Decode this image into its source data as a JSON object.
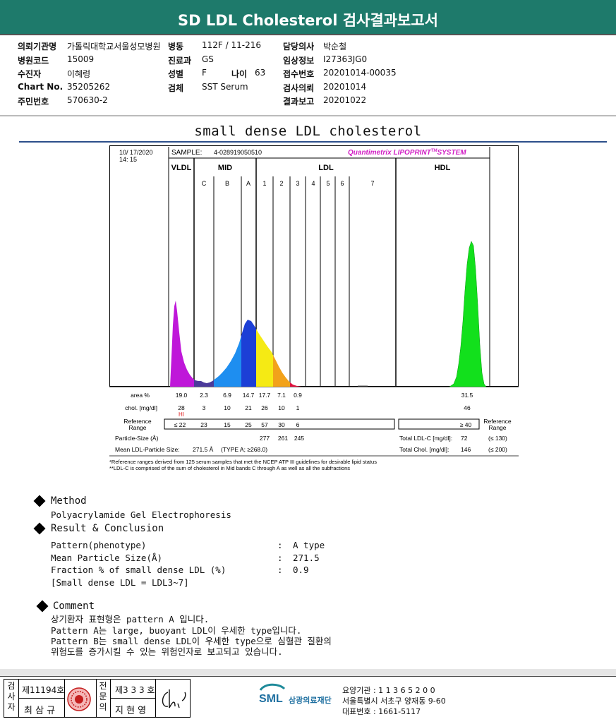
{
  "header": {
    "title": "SD LDL Cholesterol 검사결과보고서"
  },
  "info_left": [
    {
      "label": "의뢰기관명",
      "value": "가톨릭대학교서울성모병원"
    },
    {
      "label": "병원코드",
      "value": "15009"
    },
    {
      "label": "수진자",
      "value": "이혜령"
    },
    {
      "label": "Chart No.",
      "value": "35205262"
    },
    {
      "label": "주민번호",
      "value": "570630-2"
    }
  ],
  "info_mid": [
    {
      "label": "병동",
      "value": "112F / 11-216"
    },
    {
      "label": "진료과",
      "value": "GS"
    },
    {
      "label": "성별",
      "value": "F"
    },
    {
      "label": "검체",
      "value": "SST Serum"
    }
  ],
  "age": {
    "label": "나이",
    "value": "63"
  },
  "info_right": [
    {
      "label": "담당의사",
      "value": "박순철"
    },
    {
      "label": "임상정보",
      "value": "I27363JG0"
    },
    {
      "label": "접수번호",
      "value": "20201014-00035"
    },
    {
      "label": "검사의뢰",
      "value": "20201014"
    },
    {
      "label": "결과보고",
      "value": "20201022"
    }
  ],
  "doc_title": "small dense LDL cholesterol",
  "report": {
    "date": "10/ 17/2020",
    "time": "14: 15",
    "sample_label": "SAMPLE:",
    "sample_id": "4-028919050510",
    "brand": "Quantimetrix LIPOPRINT",
    "brand_tm": "TM",
    "brand_suffix": "SYSTEM",
    "brand_color": "#d11ec4",
    "regions": [
      "VLDL",
      "MID",
      "LDL",
      "HDL"
    ],
    "bands": [
      "C",
      "B",
      "A",
      "1",
      "2",
      "3",
      "4",
      "5",
      "6",
      "7"
    ],
    "area_label": "area %",
    "area_values": [
      "19.0",
      "2.3",
      "6.9",
      "14.7",
      "17.7",
      "7.1",
      "0.9",
      "31.5"
    ],
    "chol_label": "chol. [mg/dl]",
    "chol_values": [
      "28",
      "3",
      "10",
      "21",
      "26",
      "10",
      "1",
      "46"
    ],
    "hi_flag": "HI",
    "ref_label_1": "Reference",
    "ref_label_2": "Range",
    "ref_values": [
      "≤ 22",
      "23",
      "15",
      "25",
      "57",
      "30",
      "6"
    ],
    "hdl_ref": "≥ 40",
    "ref_right_1": "Reference",
    "ref_right_2": "Range",
    "particle_label": "Particle-Size (Å)",
    "particle_values": [
      "277",
      "261",
      "245"
    ],
    "total_ldl_label": "Total LDL-C [mg/dl]:",
    "total_ldl_value": "72",
    "total_ldl_ref": "(≤ 130)",
    "mean_label": "Mean LDL-Particle Size:",
    "mean_value": "271.5 Å",
    "mean_type": "(TYPE A; ≥268.0)",
    "total_chol_label": "Total Chol. [mg/dl]:",
    "total_chol_value": "146",
    "total_chol_ref": "(≤ 200)",
    "note1": "*Reference ranges derived from 125 serum samples that met the NCEP ATP III guidelines for desirable lipid status",
    "note2": "**LDL-C is comprised of the sum of cholesterol in Mid bands C through A as well as all the subfractions"
  },
  "method": {
    "title": "Method",
    "text": "Polyacrylamide Gel Electrophoresis"
  },
  "result": {
    "title": "Result & Conclusion",
    "rows": [
      {
        "label": "Pattern(phenotype)",
        "value": "A type"
      },
      {
        "label": "Mean Particle Size(Å)",
        "value": "271.5"
      },
      {
        "label": "Fraction % of small dense LDL (%)",
        "value": "0.9"
      }
    ],
    "note": "[Small dense LDL = LDL3~7]"
  },
  "comment": {
    "title": "Comment",
    "lines": [
      "상기환자 표현형은 pattern A 입니다.",
      "Pattern A는 large, buoyant LDL이 우세한 type입니다.",
      "Pattern B는 small dense LDL이 우세한 type으로 심혈관 질환의",
      "위험도를 증가시킬 수 있는 위험인자로 보고되고 있습니다."
    ]
  },
  "footer": {
    "c1": "검\n사\n자",
    "license1": "제11194호",
    "name1": "최 삼 규",
    "c2": "전\n문\n의",
    "license2": "제3 3 3 호",
    "name2": "지 현 영",
    "org_logo": "SML",
    "org_name": "삼광의료재단",
    "line1": "요양기관 : 1 1 3 6 5 2 0 0",
    "line2": "서울특별시 서초구 양재동 9-60",
    "line3": "대표번호 : 1661-5117"
  }
}
